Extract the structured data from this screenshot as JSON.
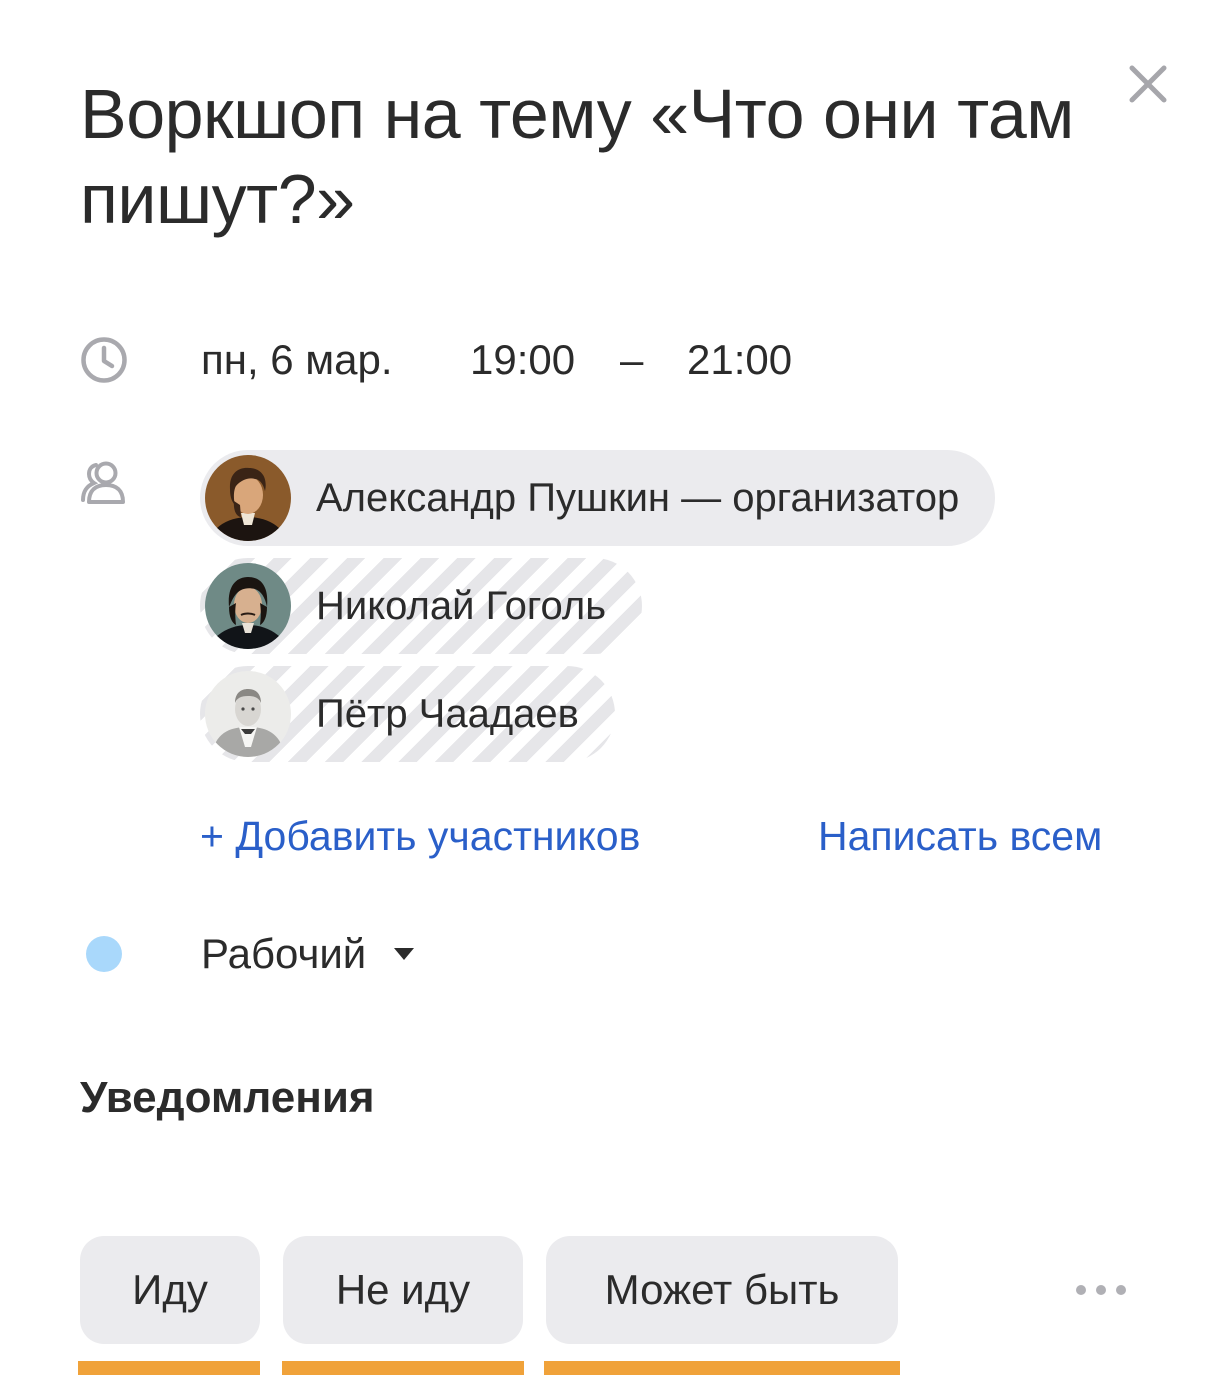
{
  "event": {
    "title": "Воркшоп на тему «Что они там пишут?»"
  },
  "datetime": {
    "date": "пн, 6 мар.",
    "start": "19:00",
    "dash": "–",
    "end": "21:00"
  },
  "participants": [
    {
      "name": "Александр Пушкин — организатор",
      "status": "organizer"
    },
    {
      "name": "Николай Гоголь",
      "status": "pending"
    },
    {
      "name": "Пётр Чаадаев",
      "status": "pending"
    }
  ],
  "actions": {
    "add_participants": "+ Добавить участников",
    "write_all": "Написать всем"
  },
  "calendar": {
    "name": "Рабочий",
    "color": "#a9d8fb"
  },
  "notifications": {
    "title": "Уведомления"
  },
  "rsvp": {
    "going": "Иду",
    "not_going": "Не иду",
    "maybe": "Может быть"
  },
  "colors": {
    "accent_link": "#2a5fc9",
    "rsvp_underline": "#f0a23a",
    "chip_bg": "#ebebee",
    "text": "#2b2b2b"
  },
  "icons": {
    "close": "close-icon",
    "clock": "clock-icon",
    "participants": "people-icon",
    "calendar_color": "calendar-color-dot-icon",
    "dropdown": "chevron-down-icon",
    "more": "more-horizontal-icon"
  }
}
